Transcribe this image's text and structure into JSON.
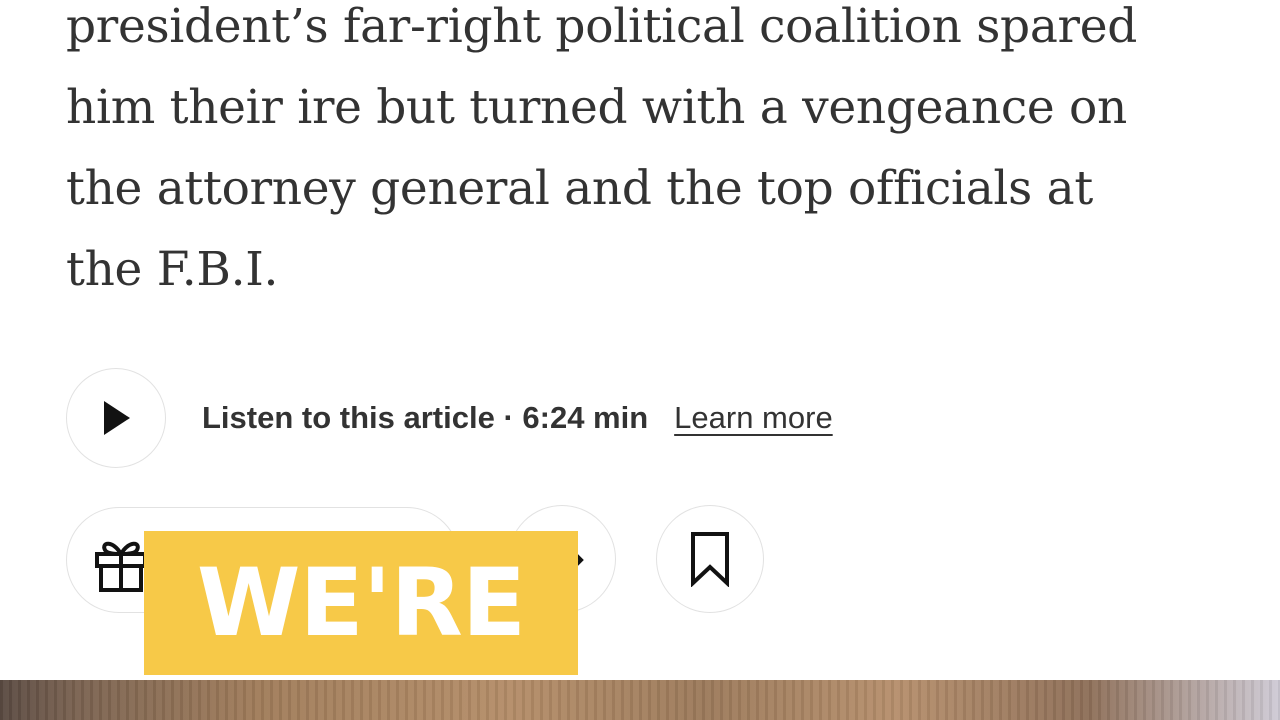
{
  "article": {
    "summary_lines": [
      "president’s far-right political coalition spared",
      "him their ire but turned with a vengeance on",
      "the attorney general and the top officials at",
      "the F.B.I."
    ]
  },
  "audio": {
    "listen_label": "Listen to this article · 6:24 min",
    "learn_more": "Learn more"
  },
  "actions": {
    "icons": [
      "play-icon",
      "gift-icon",
      "share-icon",
      "bookmark-icon"
    ]
  },
  "overlay": {
    "caption": "WE'RE",
    "caption_bg": "#f7c948"
  }
}
